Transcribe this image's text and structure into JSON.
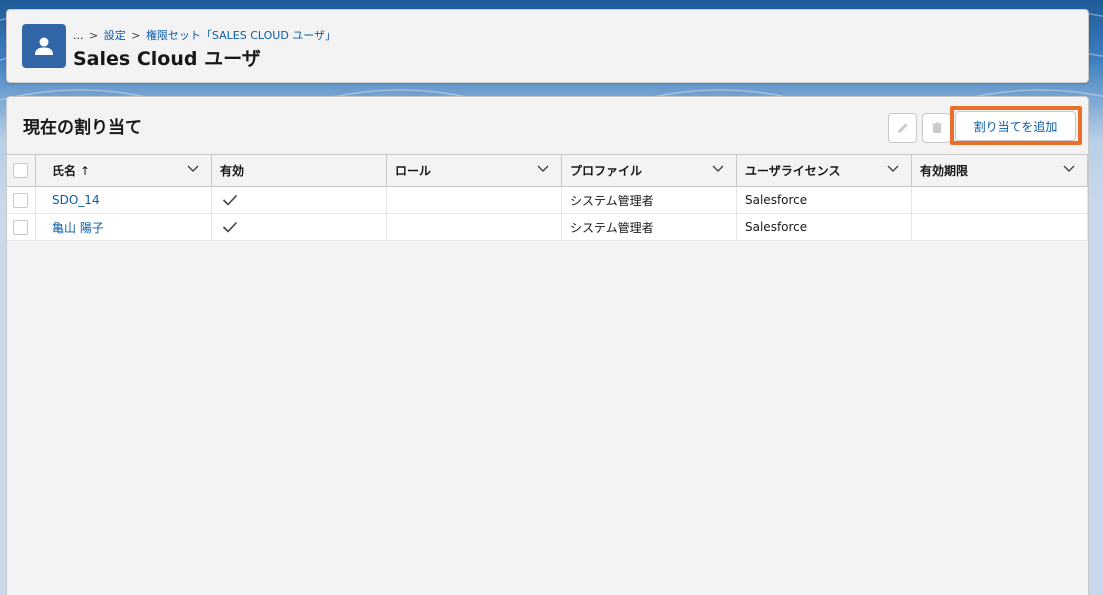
{
  "header": {
    "breadcrumb": {
      "ellipsis": "...",
      "sep": ">",
      "setup": "設定",
      "permission_set": "権限セット「SALES CLOUD ユーザ」"
    },
    "title": "Sales Cloud ユーザ",
    "icon": "user-icon"
  },
  "section": {
    "title": "現在の割り当て",
    "edit_icon": "pencil-icon",
    "delete_icon": "trash-icon",
    "add_button": "割り当てを追加"
  },
  "table": {
    "columns": [
      {
        "label": "氏名",
        "sort": "↑"
      },
      {
        "label": "有効"
      },
      {
        "label": "ロール"
      },
      {
        "label": "プロファイル"
      },
      {
        "label": "ユーザライセンス"
      },
      {
        "label": "有効期限"
      }
    ],
    "rows": [
      {
        "name": "SDO_14",
        "active": true,
        "role": "",
        "profile": "システム管理者",
        "license": "Salesforce",
        "expires": ""
      },
      {
        "name": "亀山 陽子",
        "active": true,
        "role": "",
        "profile": "システム管理者",
        "license": "Salesforce",
        "expires": ""
      }
    ]
  },
  "colors": {
    "accent": "#0b5cab",
    "highlight": "#e8702a",
    "icon_bg": "#3366a6"
  }
}
